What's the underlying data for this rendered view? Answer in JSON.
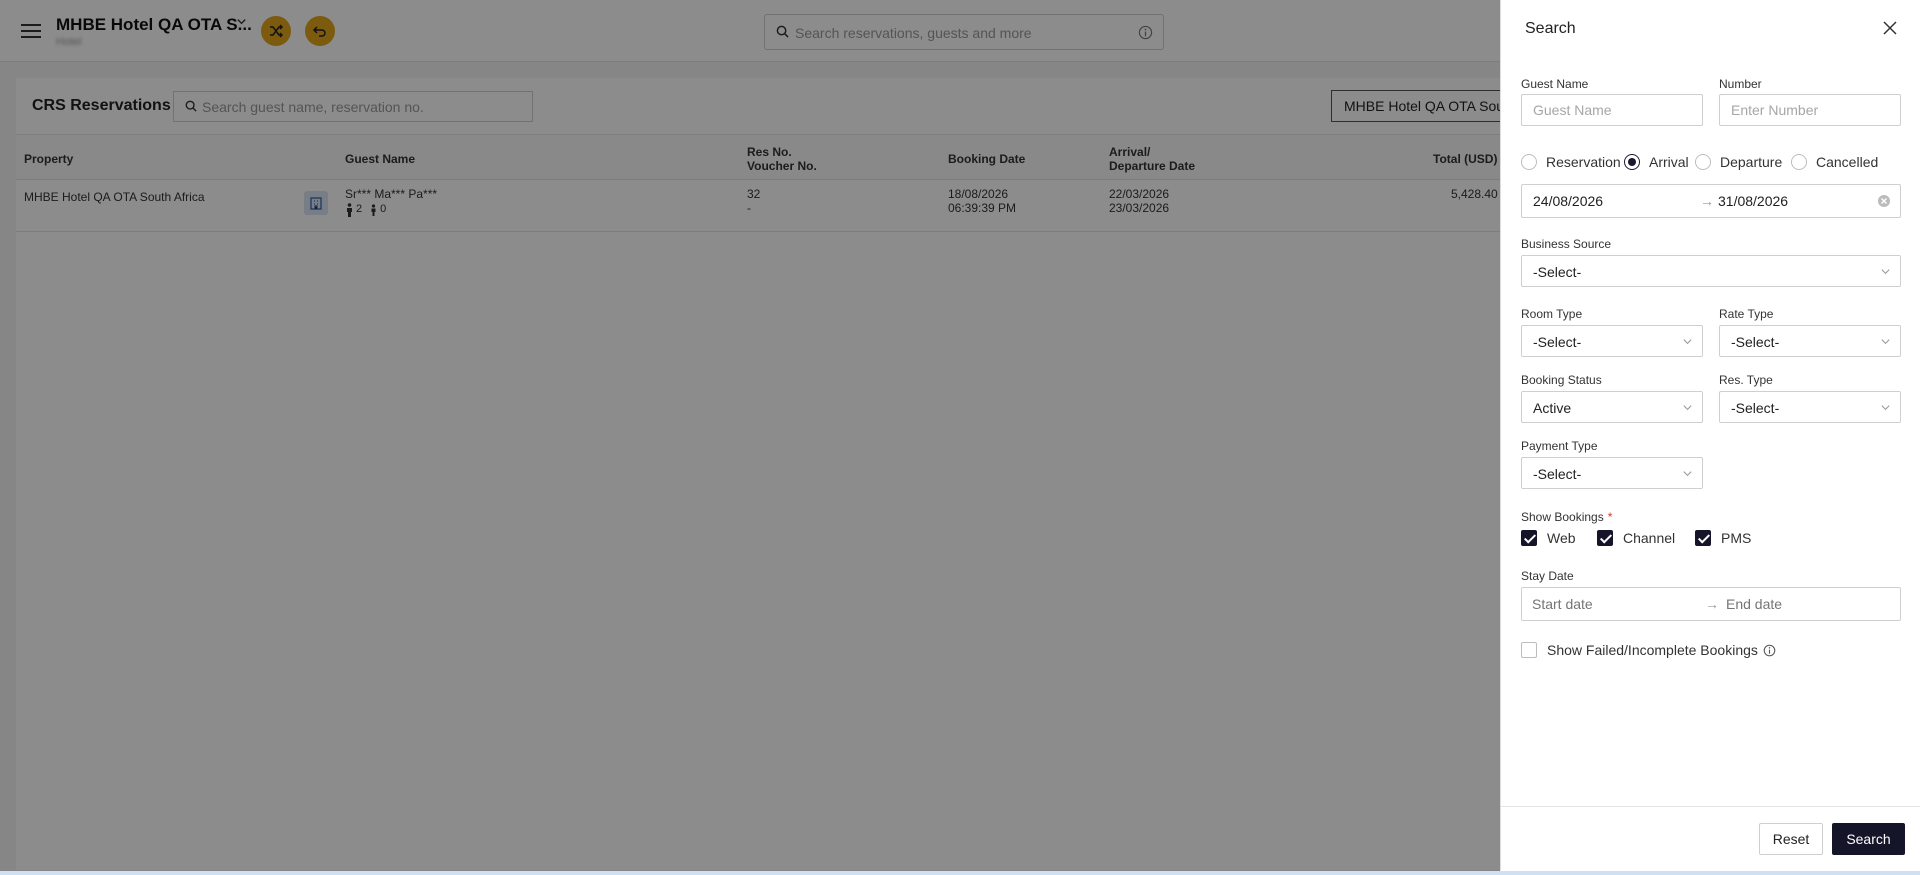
{
  "header": {
    "hotel_name": "MHBE Hotel QA OTA S...",
    "hotel_sub": "Hotel",
    "global_search_placeholder": "Search reservations, guests and more"
  },
  "page": {
    "title": "CRS Reservations",
    "search_placeholder": "Search guest name, reservation no.",
    "property_select": "MHBE Hotel QA OTA South Africa"
  },
  "table": {
    "columns": {
      "property": "Property",
      "guest_name": "Guest Name",
      "res_no": "Res No.",
      "voucher_no": "Voucher No.",
      "booking_date": "Booking Date",
      "arrival": "Arrival/",
      "departure": "Departure Date",
      "total": "Total (USD)"
    },
    "rows": [
      {
        "property": "MHBE Hotel QA OTA South Africa",
        "guest": "Sr*** Ma*** Pa***",
        "adults": "2",
        "children": "0",
        "res_no": "32",
        "voucher_no": "-",
        "booking_date": "18/08/2026",
        "booking_time": "06:39:39 PM",
        "arrival": "22/03/2026",
        "departure": "23/03/2026",
        "total": "5,428.40"
      }
    ]
  },
  "drawer": {
    "title": "Search",
    "guest_name_label": "Guest Name",
    "guest_name_placeholder": "Guest Name",
    "number_label": "Number",
    "number_placeholder": "Enter Number",
    "radios": [
      "Reservation",
      "Arrival",
      "Departure",
      "Cancelled"
    ],
    "selected_radio": "Arrival",
    "date_from": "24/08/2026",
    "date_to": "31/08/2026",
    "business_source_label": "Business Source",
    "business_source_value": "-Select-",
    "room_type_label": "Room Type",
    "room_type_value": "-Select-",
    "rate_type_label": "Rate Type",
    "rate_type_value": "-Select-",
    "booking_status_label": "Booking Status",
    "booking_status_value": "Active",
    "res_type_label": "Res. Type",
    "res_type_value": "-Select-",
    "payment_type_label": "Payment Type",
    "payment_type_value": "-Select-",
    "show_bookings_label": "Show Bookings",
    "show_bookings_required": "*",
    "bookings": [
      {
        "label": "Web",
        "checked": true
      },
      {
        "label": "Channel",
        "checked": true
      },
      {
        "label": "PMS",
        "checked": true
      }
    ],
    "stay_date_label": "Stay Date",
    "stay_start_placeholder": "Start date",
    "stay_end_placeholder": "End date",
    "show_failed_label": "Show Failed/Incomplete Bookings",
    "reset_label": "Reset",
    "search_label": "Search"
  },
  "colors": {
    "accent_dark": "#15152a",
    "action_yellow": "#e2a41a",
    "required_red": "#e0342a"
  }
}
